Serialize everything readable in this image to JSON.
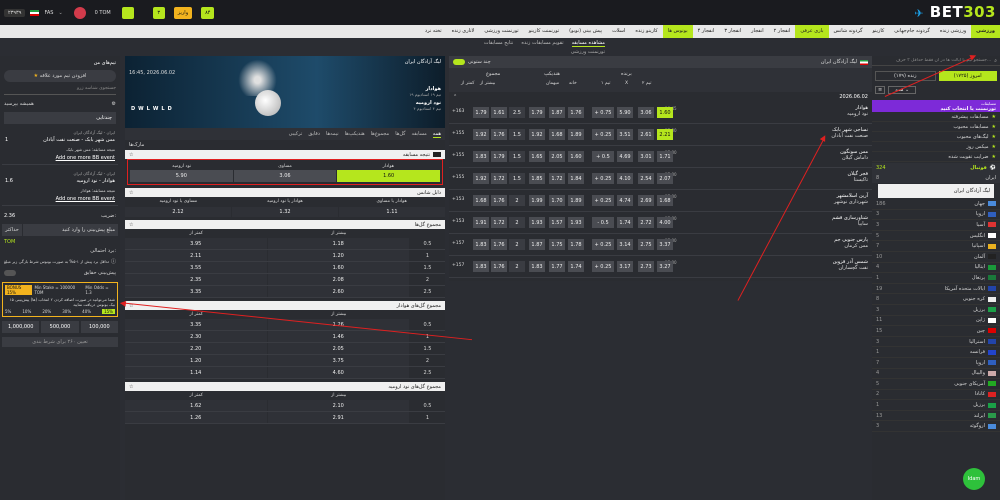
{
  "topbar": {
    "logo_prefix": "BET",
    "logo_number": "303",
    "balance": "0 TOM",
    "currency": "FAS",
    "right_balance": "۲۳۹۳۹",
    "deposit_label": "واریز",
    "gift_label": "۳",
    "cash_label": "۸۴"
  },
  "nav": [
    {
      "label": "ورزشی",
      "active": true
    },
    {
      "label": "ورزشی زنده"
    },
    {
      "label": "گردونه جام‌جهانی"
    },
    {
      "label": "کازینو"
    },
    {
      "label": "گردونه شانس"
    },
    {
      "label": "بازی عرفی",
      "green": true
    },
    {
      "label": "انفجار ۲"
    },
    {
      "label": "انفجار"
    },
    {
      "label": "انفجار ۳"
    },
    {
      "label": "انفجار ۴"
    },
    {
      "label": "بونوس ها",
      "green": true
    },
    {
      "label": "کازینو زنده"
    },
    {
      "label": "اسلات"
    },
    {
      "label": "پیش بینی (نوبو)"
    },
    {
      "label": "تورنمنت کازینو"
    },
    {
      "label": "تورنمنت ورزشی"
    },
    {
      "label": "لاتاری زنده"
    },
    {
      "label": "تخته نرد"
    }
  ],
  "subnav": [
    "مشاهده مسابقه",
    "تقویم مسابقات زنده",
    "نتایج مسابقات"
  ],
  "subnav2": "تورنمنت ورزشی",
  "left_sidebar": {
    "search_placeholder": "جستجو تیم یا ایالت ها در آن فقط حداقل ۳ حرف...",
    "tab_today": "امروز (۱۷۲۵)",
    "tab_live": "زنده (۱۷۹)",
    "tournaments_title": "مسابقات",
    "tournaments_subtitle": "تورنمنت یا انتخاب کنید",
    "menu": [
      "مسابقات پیشرفته",
      "مسابقات محبوب",
      "لیگ‌های محبوب",
      "میکس روز",
      "ضرایب تقویت شده"
    ],
    "football_label": "فوتبال",
    "football_count": "324",
    "country_selected": "ایران",
    "league_selected": "لیگ آزادگان ایران",
    "countries": [
      {
        "name": "جهان",
        "count": "186"
      },
      {
        "name": "اروپا",
        "count": "3"
      },
      {
        "name": "آسیا",
        "count": "3"
      },
      {
        "name": "انگلیس",
        "count": "5"
      },
      {
        "name": "اسپانیا",
        "count": "7"
      },
      {
        "name": "آلمان",
        "count": "10"
      },
      {
        "name": "ایتالیا",
        "count": "4"
      },
      {
        "name": "پرتغال",
        "count": "1"
      },
      {
        "name": "ایالات متحده آمریکا",
        "count": "19"
      },
      {
        "name": "کره جنوبی",
        "count": "8"
      },
      {
        "name": "برزیل",
        "count": "3"
      },
      {
        "name": "ژاپن",
        "count": "11"
      },
      {
        "name": "چین",
        "count": "15"
      },
      {
        "name": "استرالیا",
        "count": "3"
      },
      {
        "name": "فرانسه",
        "count": "1"
      },
      {
        "name": "اروپا",
        "count": "7"
      },
      {
        "name": "والیبال",
        "count": "4"
      },
      {
        "name": "آمریکای جنوبی",
        "count": "5"
      },
      {
        "name": "کانادا",
        "count": "2"
      },
      {
        "name": "برزیل",
        "count": "1"
      },
      {
        "name": "ایرلند",
        "count": "13"
      },
      {
        "name": "اروگوئه",
        "count": "3"
      }
    ]
  },
  "matches_panel": {
    "league": "لیگ آزادگان ایران",
    "toggle_label": "چند ستونی",
    "header_groups": [
      "برنده",
      "هندیکپ",
      "مجموع"
    ],
    "header_cols": [
      "تیم ۱",
      "X",
      "تیم ۲",
      "خانه",
      "میهمان",
      "بیشتر از",
      "کمتر از"
    ],
    "date": "2026.06.02",
    "matches": [
      {
        "time": "16:45",
        "team1": "هوادار",
        "team2": "نود ارومیه",
        "odds": [
          "1.60",
          "3.06",
          "5.90",
          "+ 0.75",
          "1.76",
          "1.87",
          "1.79",
          "2.5",
          "1.61",
          "1.79"
        ],
        "more": "+163"
      },
      {
        "time": "17:00",
        "team1": "نساجی شهر بابک",
        "team2": "صنعت نفت آبادان",
        "odds": [
          "2.21",
          "2.61",
          "3.51",
          "+ 0.25",
          "1.89",
          "1.68",
          "1.92",
          "1.5",
          "1.76",
          "1.92"
        ],
        "more": "+155"
      },
      {
        "time": "17:00",
        "team1": "مس سونگون",
        "team2": "داماش گیلان",
        "odds": [
          "1.71",
          "3.01",
          "4.69",
          "+ 0.5",
          "1.60",
          "2.05",
          "1.65",
          "1.5",
          "1.79",
          "1.83"
        ],
        "more": "+155"
      },
      {
        "time": "17:00",
        "team1": "فجر گیلان",
        "team2": "تاکیستا",
        "odds": [
          "2.07",
          "2.54",
          "4.10",
          "+ 0.25",
          "1.84",
          "1.72",
          "1.85",
          "1.5",
          "1.72",
          "1.92"
        ],
        "more": "+155"
      },
      {
        "time": "17:00",
        "team1": "آرین اسلامشهر",
        "team2": "شهرداری نوشهر",
        "odds": [
          "1.68",
          "2.69",
          "4.74",
          "+ 0.25",
          "1.89",
          "1.70",
          "1.99",
          "2",
          "1.76",
          "1.68"
        ],
        "more": "+153"
      },
      {
        "time": "17:00",
        "team1": "شناورسازی قشم",
        "team2": "سایپا",
        "odds": [
          "4.00",
          "2.72",
          "1.74",
          "- 0.5",
          "1.93",
          "1.57",
          "1.93",
          "2",
          "1.72",
          "1.91"
        ],
        "more": "+153"
      },
      {
        "time": "17:00",
        "team1": "پارس جنوبی جم",
        "team2": "مس کرمان",
        "odds": [
          "3.37",
          "2.75",
          "3.14",
          "+ 0.25",
          "1.78",
          "1.75",
          "1.87",
          "2",
          "1.76",
          "1.83"
        ],
        "more": "+157"
      },
      {
        "time": "17:00",
        "team1": "شمس آذر قزوین",
        "team2": "نفت گچساران",
        "odds": [
          "3.27",
          "2.73",
          "3.17",
          "+ 0.25",
          "1.74",
          "1.77",
          "1.83",
          "2",
          "1.76",
          "1.83"
        ],
        "more": "+157"
      }
    ]
  },
  "event_panel": {
    "league": "لیگ آزادگان ایران",
    "datetime": "16:45, 2026.06.02",
    "team1": "هوادار",
    "team1_sub": "تیم ۱۹ استادیوم ۱۹",
    "team2": "نود ارومیه",
    "team2_sub": "تیم ۴ استادیوم ۴",
    "form": [
      "D",
      "W",
      "L",
      "W",
      "L",
      "D"
    ],
    "tabs": [
      "همه",
      "مسابقه",
      "گل‌ها",
      "مجموع‌ها",
      "هندیکپ‌ها",
      "نیمه‌ها",
      "دقایق",
      "ترکیبی"
    ],
    "section_label": "مارک‌ها",
    "result_title": "نتیجه مسابقه",
    "result_headers": [
      "هوادار",
      "مساوی",
      "نود ارومیه"
    ],
    "result_values": [
      "1.60",
      "3.06",
      "5.90"
    ],
    "dc_title": "دابل شانس",
    "dc_headers": [
      "هوادار یا مساوی",
      "هوادار یا نود ارومیه",
      "مساوی یا نود ارومیه"
    ],
    "dc_values": [
      "1.11",
      "1.32",
      "2.12"
    ],
    "total_title": "مجموع گل‌ها",
    "total_headers": [
      "بیشتر از",
      "کمتر از"
    ],
    "total_rows": [
      [
        "0.5",
        "1.18",
        "3.95"
      ],
      [
        "1",
        "1.20",
        "2.11"
      ],
      [
        "1.5",
        "1.60",
        "3.55"
      ],
      [
        "2",
        "2.08",
        "2.35"
      ],
      [
        "2.5",
        "2.60",
        "3.35"
      ]
    ],
    "total2_title": "مجموع گل‌های هوادار",
    "total2_rows": [
      [
        "0.5",
        "1.26",
        "3.35"
      ],
      [
        "1",
        "1.46",
        "2.30"
      ],
      [
        "1.5",
        "2.05",
        "2.20"
      ],
      [
        "2",
        "3.75",
        "1.20"
      ],
      [
        "2.5",
        "4.60",
        "1.14"
      ]
    ],
    "total3_title": "مجموع گل‌های نود ارومیه",
    "total3_rows": [
      [
        "0.5",
        "2.10",
        "1.62"
      ],
      [
        "1",
        "2.91",
        "1.26"
      ]
    ]
  },
  "betslip": {
    "my_teams": "تیم‌های من",
    "add_team": "افزودن تیم مورد علاقه",
    "search_placeholder": "جستجوی شناسه زرو",
    "always_ask": "همیشه بپرسید",
    "multi_label": "چندتایی",
    "entries": [
      {
        "league": "ایران - لیگ آزادگان ایران",
        "match": "مس شهر بابک - صنعت نفت آبادان",
        "pick": "نتیجه مسابقه: مس شهر بابک",
        "odd": "1"
      },
      {
        "league": "ایران - لیگ آزادگان ایران",
        "match": "هوادار - نود ارومیه",
        "pick": "نتیجه مسابقه: هوادار",
        "odd": "1.6"
      }
    ],
    "add_more": "Add one more BB event",
    "coef_label": "ضریب:",
    "coef_value": "2.36",
    "stake_placeholder": "مبلغ پیش‌بینی را وارد کنید",
    "stake_button": "حداکثر",
    "currency": "TOM",
    "possible_win_label": "برد احتمالی:",
    "promo_note": "حداقل برد پیش از ۱-۵% به صورت بونوس شرط بازگی زیر مبلغ",
    "quick_bet": "پیش‌بینی حقایق",
    "bonus_badge": "BONUS 15%",
    "min_stake": "Min Stake = 100000 TOM",
    "min_odds": "Min Odds = 1.3",
    "bonus_text": "شما می‌توانید در صورت اضافه کردن ۲ انتخاب (ها) پیش‌بینی ۱۵ بیک بونوس دریافت نمایید",
    "percents": [
      "5%",
      "10%",
      "20%",
      "30%",
      "40%",
      "15%"
    ],
    "amounts": [
      "1,000,000",
      "500,000",
      "100,000"
    ],
    "submit": "تعیین ۲۶۰ برای شرط بندی"
  },
  "chat_badge": "Idam"
}
